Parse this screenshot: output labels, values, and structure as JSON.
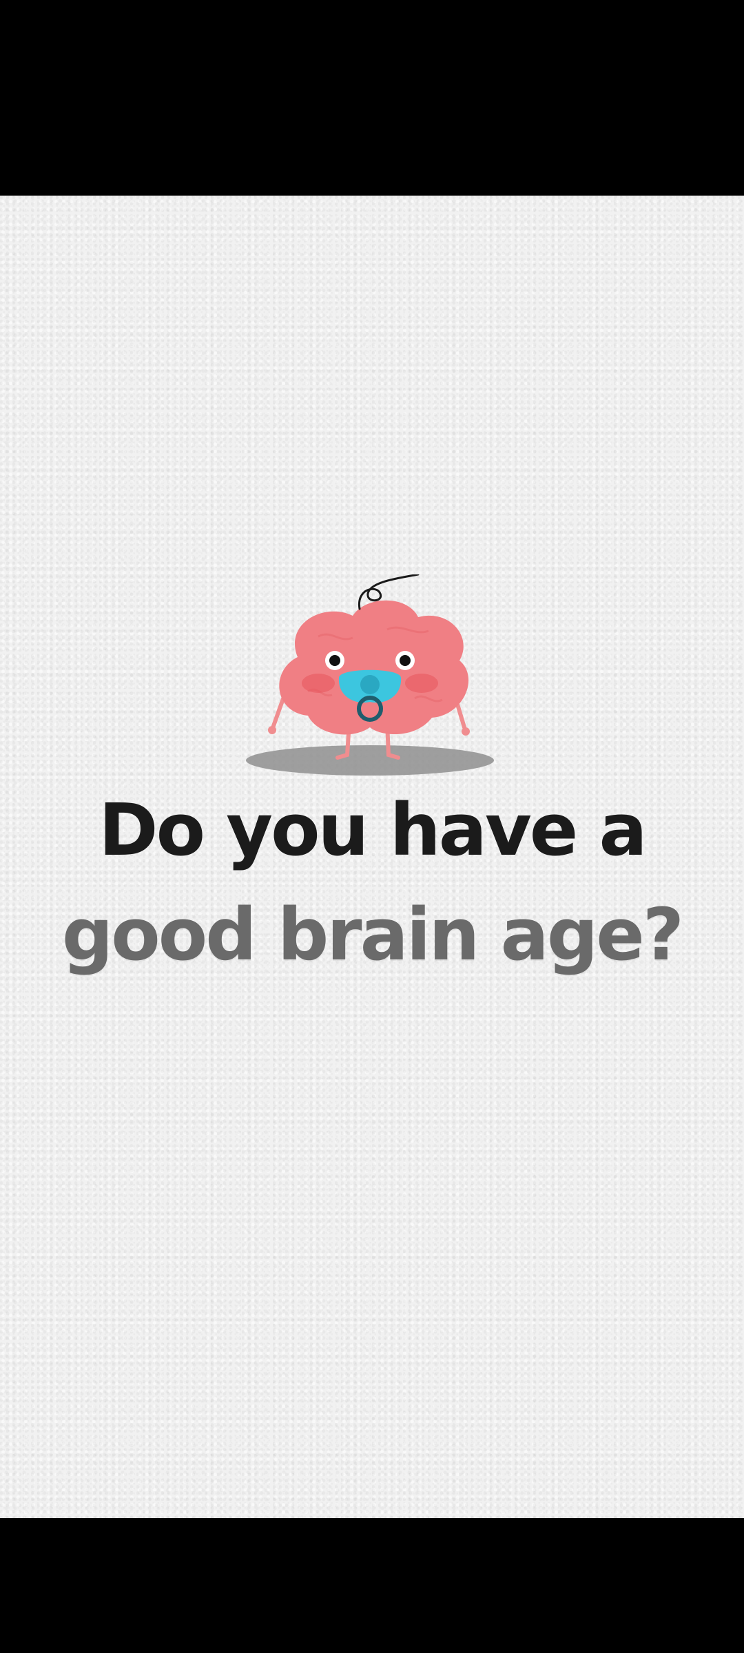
{
  "headline": {
    "line1": "Do you have a",
    "line2": "good brain age?"
  },
  "mascot": {
    "icon": "baby-brain-with-pacifier-icon",
    "colors": {
      "brain": "#f07f84",
      "cheek": "#e8585f",
      "pacifier": "#3cc6df",
      "shadow": "#8f8f8f"
    }
  },
  "colors": {
    "background": "#f1f1f1",
    "line1_text": "#1b1b1b",
    "line2_text": "#6a6a6a",
    "letterbox": "#000000"
  }
}
